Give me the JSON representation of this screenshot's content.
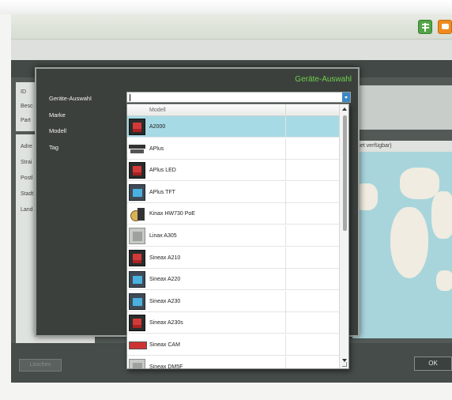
{
  "modal": {
    "title": "Geräte-Auswahl",
    "labels": [
      "Geräte-Auswahl",
      "Marke",
      "Modell",
      "Tag"
    ]
  },
  "background": {
    "left_labels": [
      "ID",
      "Besc",
      "Part",
      "Adre",
      "Strai",
      "Postl",
      "Stadt",
      "Land"
    ],
    "net_label": "net verfügbar)",
    "delete_button": "Löschen",
    "ok_button": "OK"
  },
  "dropdown": {
    "column_header": "Modell",
    "selected_index": 0,
    "items": [
      {
        "label": "A2000",
        "icon": "panel-meter-icon"
      },
      {
        "label": "APlus",
        "icon": "stacked-meter-icon"
      },
      {
        "label": "APlus LED",
        "icon": "panel-meter-icon"
      },
      {
        "label": "APlus TFT",
        "icon": "blue-display-meter-icon"
      },
      {
        "label": "Kinax HW730 PoE",
        "icon": "angle-sensor-icon"
      },
      {
        "label": "Linax A305",
        "icon": "gray-meter-icon"
      },
      {
        "label": "Sineax A210",
        "icon": "panel-meter-icon"
      },
      {
        "label": "Sineax A220",
        "icon": "blue-display-meter-icon"
      },
      {
        "label": "Sineax A230",
        "icon": "blue-display-meter-icon"
      },
      {
        "label": "Sineax A230s",
        "icon": "panel-meter-icon"
      },
      {
        "label": "Sineax CAM",
        "icon": "strip-meter-icon"
      },
      {
        "label": "Sineax DM5F",
        "icon": "gray-meter-icon"
      }
    ]
  },
  "colors": {
    "title_green": "#6fcf4a",
    "selection": "#a6dae5",
    "accent_blue": "#3c88c6"
  }
}
